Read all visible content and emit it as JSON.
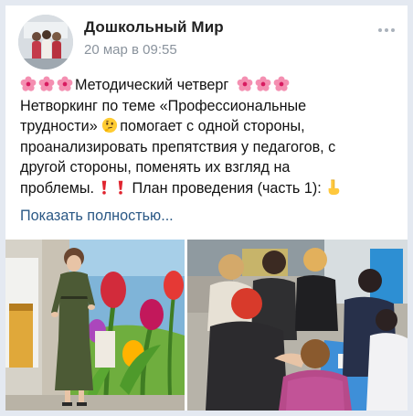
{
  "post": {
    "author": "Дошкольный Мир",
    "date": "20 мар в 09:55",
    "more_icon": "more-dots-icon",
    "lines": [
      "Методический четверг",
      "Нетворкинг по теме «Профессиональные",
      "трудности»",
      "помогает с одной стороны,",
      "проанализировать препятствия у педагогов, с",
      "другой стороны, поменять их взгляд на",
      "проблемы.",
      "План проведения (часть 1):"
    ],
    "show_more": "Показать полностью..."
  },
  "icons": {
    "flower": "cherry-blossom-icon",
    "thinking": "thinking-face-icon",
    "exclamation": "red-exclamation-icon",
    "pointing": "pointing-down-icon"
  },
  "colors": {
    "link": "#2a5885",
    "date": "#8a939d",
    "background": "#e4e9f1"
  }
}
